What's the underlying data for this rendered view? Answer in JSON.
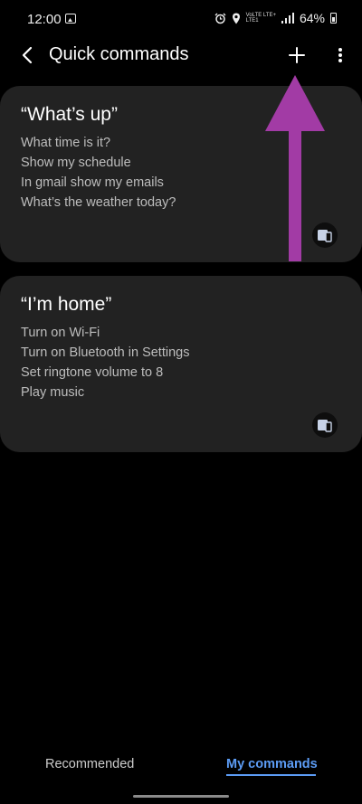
{
  "status": {
    "time": "12:00",
    "network_top": "VoLTE LTE+",
    "network_bottom": "LTE1",
    "battery": "64%"
  },
  "header": {
    "title": "Quick commands"
  },
  "commands": [
    {
      "title": "“What’s up”",
      "lines": [
        "What time is it?",
        "Show my schedule",
        "In gmail show my emails",
        "What’s the weather today?"
      ]
    },
    {
      "title": "“I’m home”",
      "lines": [
        "Turn on Wi-Fi",
        "Turn on Bluetooth in Settings",
        "Set ringtone volume to 8",
        "Play music"
      ]
    }
  ],
  "tabs": {
    "recommended": "Recommended",
    "my_commands": "My commands",
    "selected": "My commands"
  },
  "colors": {
    "accent": "#5c9cf5",
    "annotation_arrow": "#a23ba5",
    "card_bg": "#222222"
  },
  "icons": {
    "back": "chevron-left-icon",
    "add": "plus-icon",
    "more": "more-vertical-icon",
    "device": "phone-tablet-icon"
  }
}
